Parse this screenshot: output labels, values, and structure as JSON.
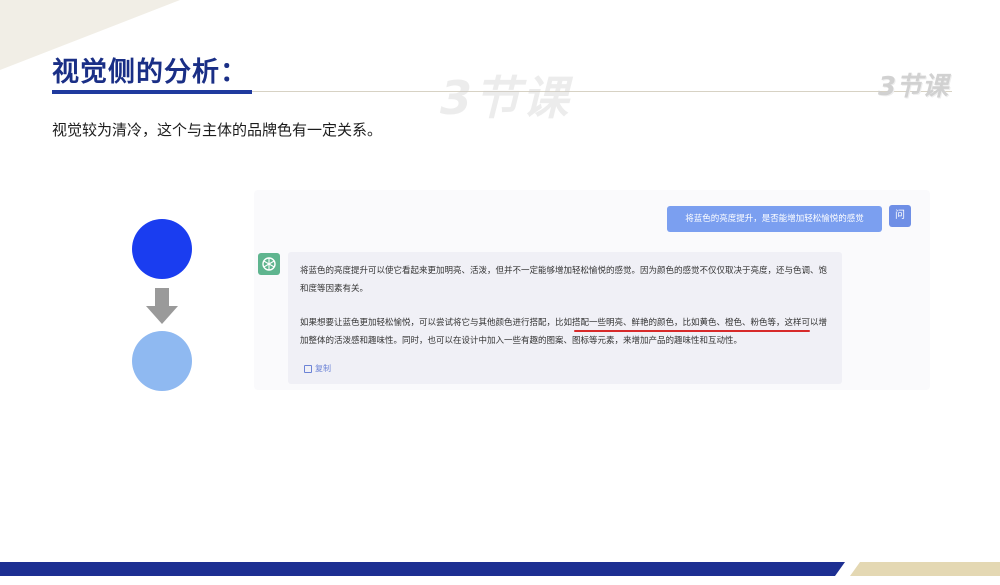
{
  "slide": {
    "title": "视觉侧的分析：",
    "subtitle": "视觉较为清冷，这个与主体的品牌色有一定关系。"
  },
  "watermark": {
    "big": "3节课",
    "corner": "3节课"
  },
  "chat": {
    "user_message": "将蓝色的亮度提升，是否能增加轻松愉悦的感觉",
    "user_avatar_label": "问",
    "answer_para1": "将蓝色的亮度提升可以使它看起来更加明亮、活泼，但并不一定能够增加轻松愉悦的感觉。因为颜色的感觉不仅仅取决于亮度，还与色调、饱和度等因素有关。",
    "answer_para2_a": "如果想要让蓝色更加轻松愉悦，可以尝试将它与其他颜色进行搭配，",
    "answer_para2_highlight": "比如搭配一些明亮、鲜艳的颜色，比如黄色、橙色、粉色等",
    "answer_para2_b": "，这样可以增加整体的活泼感和趣味性。同时，也可以在设计中加入一些有趣的图案、图标等元素，来增加产品的趣味性和互动性。",
    "copy_label": "复制"
  },
  "colors": {
    "title_blue": "#1a2f86",
    "dark_circle": "#1a3df0",
    "light_circle": "#8fb9f1",
    "highlight_red": "#d72a2a",
    "footer_blue": "#1d2f92",
    "footer_gold": "#e4d8b3"
  }
}
